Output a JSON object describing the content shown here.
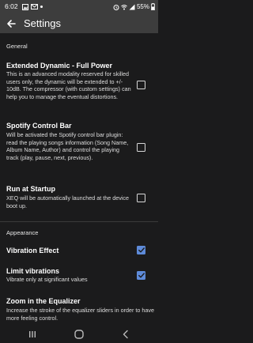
{
  "status_bar": {
    "time": "6:02",
    "battery": "55%",
    "icons": [
      "image-icon",
      "mail-icon",
      "dot-icon",
      "alarm-icon",
      "wifi-icon",
      "signal-icon",
      "battery-icon"
    ]
  },
  "app_bar": {
    "title": "Settings",
    "back_icon": "arrow-left-icon"
  },
  "sections": [
    {
      "header": "General",
      "items": [
        {
          "title": "Extended Dynamic - Full Power",
          "summary": "This is an advanced modality reserved for skilled users only, the dynamic will be extended to +/- 10dB. The compressor (with custom settings) can help you to manage the eventual distortions.",
          "checked": false
        },
        {
          "title": "Spotify Control Bar",
          "summary": "Will be activated the Spotify control bar plugin: read the playing songs information (Song Name, Album Name, Author) and control the playing track (play, pause, next, previous).",
          "checked": false
        },
        {
          "title": "Run at Startup",
          "summary": "XEQ will be automatically launched at the device boot up.",
          "checked": false
        }
      ]
    },
    {
      "header": "Appearance",
      "items": [
        {
          "title": "Vibration Effect",
          "summary": "",
          "checked": true
        },
        {
          "title": "Limit vibrations",
          "summary": "Vibrate only at significant values",
          "checked": true
        },
        {
          "title": "Zoom in the Equalizer",
          "summary": "Increase the stroke of the equalizer sliders in order to have more feeling control.",
          "checked": null
        }
      ]
    }
  ],
  "nav_bar": {
    "icons": [
      "recent-apps-icon",
      "home-icon",
      "back-icon"
    ]
  },
  "colors": {
    "bar_background": "#3d3d3d",
    "background": "#1b1b1c",
    "accent": "#5e8bd9"
  }
}
